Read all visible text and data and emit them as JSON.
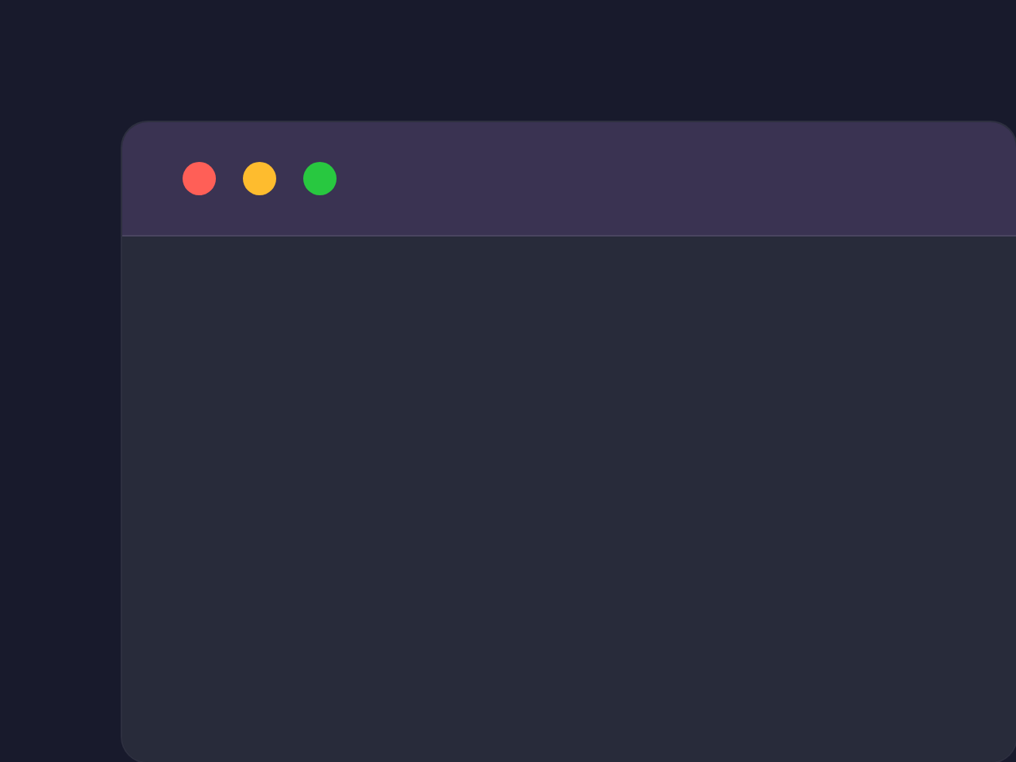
{
  "window": {
    "controls": [
      {
        "color": "#ff5f57"
      },
      {
        "color": "#febc2e"
      },
      {
        "color": "#28c840"
      }
    ]
  }
}
